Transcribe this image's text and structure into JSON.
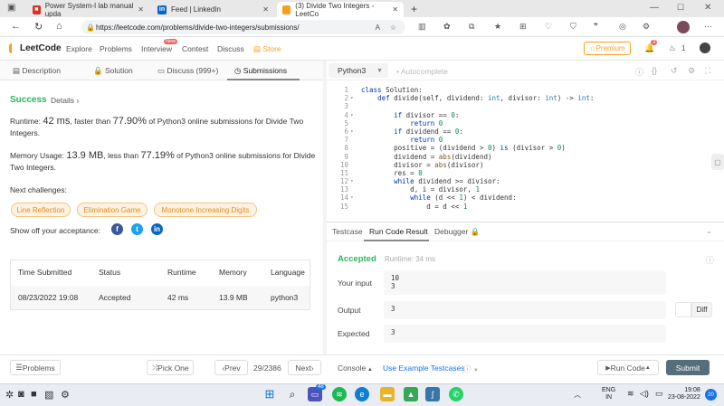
{
  "browser": {
    "tabs": [
      {
        "label": "Power System-I lab manual upda",
        "favicon": "PDF",
        "color": "#d93025"
      },
      {
        "label": "Feed | LinkedIn",
        "favicon": "in",
        "color": "#0a66c2"
      },
      {
        "label": "(3) Divide Two Integers - LeetCo",
        "favicon": "L",
        "color": "#f89f1b"
      }
    ],
    "url": "https://leetcode.com/problems/divide-two-integers/submissions/"
  },
  "lcnav": {
    "logo": "LeetCode",
    "links": [
      "Explore",
      "Problems",
      "Interview",
      "Contest",
      "Discuss",
      "Store"
    ],
    "new_badge": "New",
    "premium": "Premium",
    "notif_count": "3",
    "streak": "1"
  },
  "left_tabs": [
    "Description",
    "Solution",
    "Discuss (999+)",
    "Submissions"
  ],
  "result": {
    "status": "Success",
    "details": "Details",
    "runtime_prefix": "Runtime:",
    "runtime_value": "42 ms",
    "runtime_mid": ", faster than",
    "runtime_pct": "77.90%",
    "runtime_suffix": "of Python3 online submissions for Divide Two",
    "runtime_suffix2": "Integers.",
    "memory_prefix": "Memory Usage:",
    "memory_value": "13.9 MB",
    "memory_mid": ", less than",
    "memory_pct": "77.19%",
    "memory_suffix": "of Python3 online submissions for Divide",
    "memory_suffix2": "Two Integers.",
    "next_label": "Next challenges:",
    "challenges": [
      "Line Reflection",
      "Elimination Game",
      "Monotone Increasing Digits"
    ],
    "share_label": "Show off your acceptance:"
  },
  "table": {
    "headers": [
      "Time Submitted",
      "Status",
      "Runtime",
      "Memory",
      "Language"
    ],
    "row": [
      "08/23/2022 19:08",
      "Accepted",
      "42 ms",
      "13.9 MB",
      "python3"
    ]
  },
  "editor": {
    "language": "Python3",
    "autocomplete": "Autocomplete",
    "lines": [
      {
        "n": "1",
        "t": "class Solution:"
      },
      {
        "n": "2",
        "t": "    def divide(self, dividend: int, divisor: int) -> int:"
      },
      {
        "n": "3",
        "t": ""
      },
      {
        "n": "4",
        "t": "        if divisor == 0:"
      },
      {
        "n": "5",
        "t": "            return 0"
      },
      {
        "n": "6",
        "t": "        if dividend == 0:"
      },
      {
        "n": "7",
        "t": "            return 0"
      },
      {
        "n": "8",
        "t": "        positive = (dividend > 0) is (divisor > 0)"
      },
      {
        "n": "9",
        "t": "        dividend = abs(dividend)"
      },
      {
        "n": "10",
        "t": "        divisor = abs(divisor)"
      },
      {
        "n": "11",
        "t": "        res = 0"
      },
      {
        "n": "12",
        "t": "        while dividend >= divisor:"
      },
      {
        "n": "13",
        "t": "            d, i = divisor, 1"
      },
      {
        "n": "14",
        "t": "            while (d << 1) < dividend:"
      },
      {
        "n": "15",
        "t": "                d = d << 1"
      }
    ]
  },
  "result_panel": {
    "tabs": [
      "Testcase",
      "Run Code Result",
      "Debugger"
    ],
    "accepted": "Accepted",
    "runtime": "Runtime: 34 ms",
    "input_label": "Your input",
    "input_line1": "10",
    "input_line2": "3",
    "output_label": "Output",
    "output_value": "3",
    "diff": "Diff",
    "expected_label": "Expected",
    "expected_value": "3"
  },
  "bottom": {
    "problems": "Problems",
    "pick_one": "Pick One",
    "prev": "Prev",
    "page": "29/2386",
    "next": "Next",
    "console": "Console",
    "use_example": "Use Example Testcases",
    "run_code": "Run Code",
    "submit": "Submit"
  },
  "taskbar": {
    "lang": "ENG",
    "region": "IN",
    "time": "19:08",
    "date": "23-08-2022",
    "badge": "20",
    "chat_badge": "48"
  }
}
